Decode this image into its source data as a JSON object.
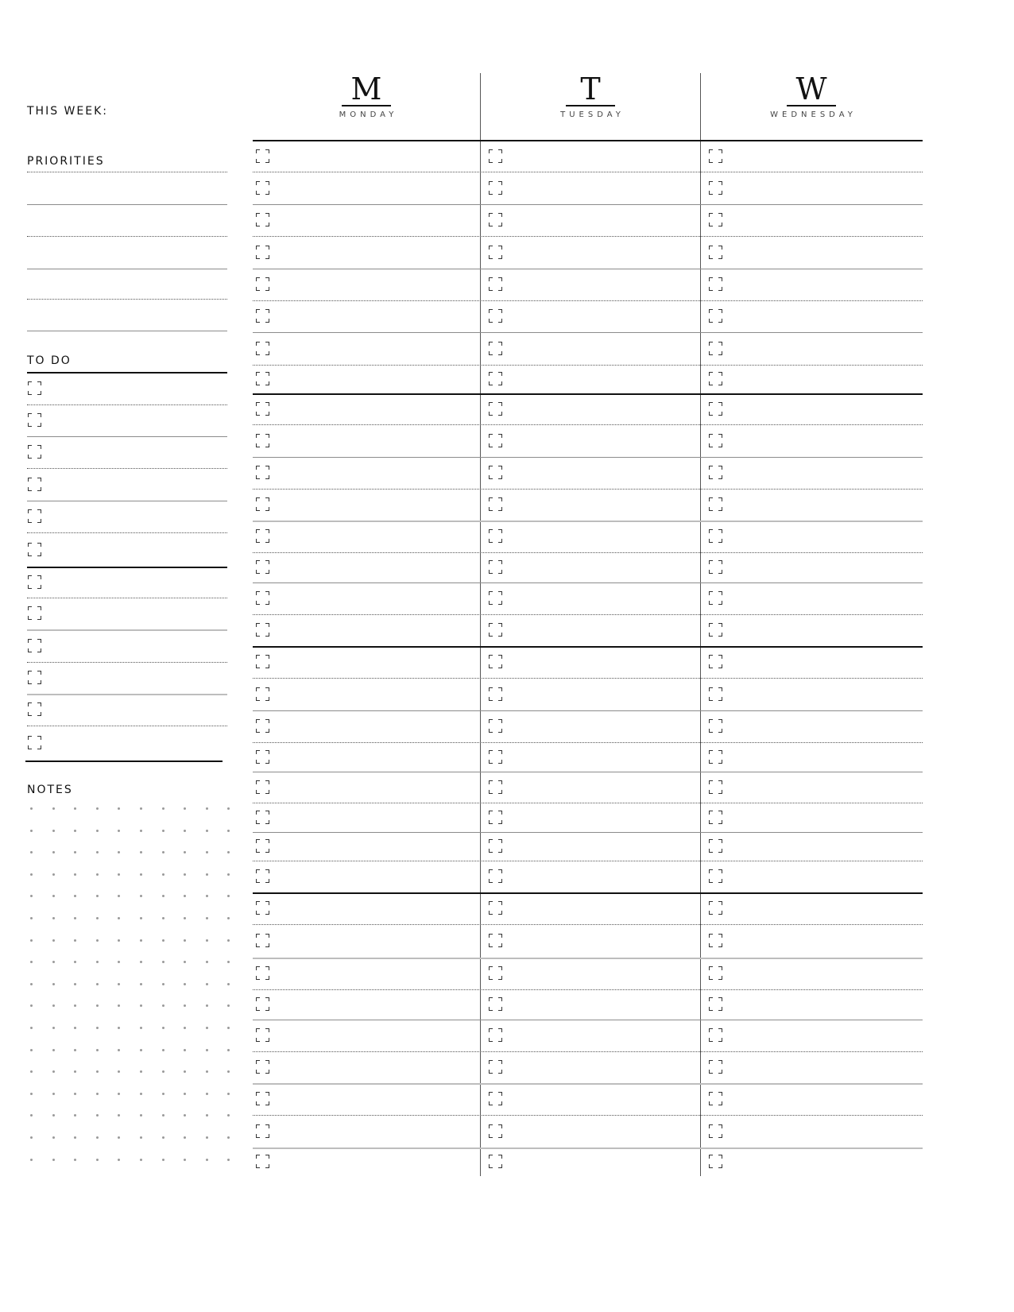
{
  "page": {
    "this_week_label": "THIS WEEK:",
    "priorities_label": "PRIORITIES",
    "todo_label": "TO DO",
    "notes_label": "NOTES"
  },
  "days": [
    {
      "letter": "M",
      "name": "MONDAY"
    },
    {
      "letter": "T",
      "name": "TUESDAY"
    },
    {
      "letter": "W",
      "name": "WEDNESDAY"
    }
  ],
  "priorities": {
    "count": 5
  },
  "todo": {
    "count": 12
  },
  "day_slots": {
    "count_per_day": 33
  },
  "notes_grid": {
    "columns": 10,
    "rows": 17
  },
  "icons": {
    "checkbox": "corner-bracket-checkbox-icon"
  },
  "colors": {
    "ink": "#111111",
    "rule": "#8c8c8c",
    "light_rule": "#bdbdbd",
    "dot": "#9a9a9a"
  }
}
